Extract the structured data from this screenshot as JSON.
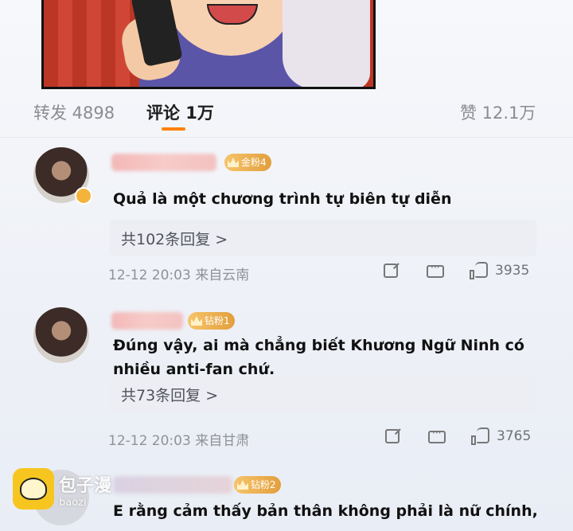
{
  "stats": {
    "repost_label": "转发 4898",
    "comment_label": "评论 1万",
    "like_label": "赞 12.1万"
  },
  "colors": {
    "accent": "#ff8200",
    "badge": "#e29f3c",
    "meta": "#8f9298"
  },
  "comments": [
    {
      "badge": "金粉4",
      "text": "Quả là một chương trình tự biên tự diễn",
      "replies": "共102条回复 >",
      "time_location": "12-12 20:03 来自云南",
      "likes": "3935"
    },
    {
      "badge": "钻粉1",
      "text": "Đúng vậy, ai mà chẳng biết Khương Ngữ Ninh có nhiều anti-fan chứ.",
      "replies": "共73条回复 >",
      "time_location": "12-12 20:03 来自甘肃",
      "likes": "3765"
    },
    {
      "badge": "钻粉2",
      "text": "E rằng cảm thấy bản thân không phải là nữ chính,"
    }
  ],
  "watermark": {
    "brand": "包子漫",
    "url": "baozi"
  },
  "icons": [
    "share-icon",
    "comment-icon",
    "like-icon",
    "crown-icon"
  ]
}
